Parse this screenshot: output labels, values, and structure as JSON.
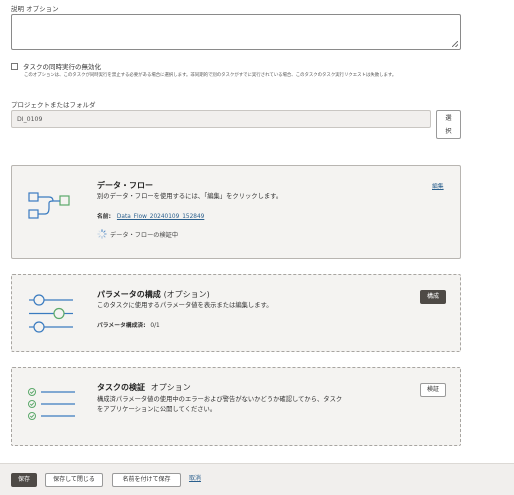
{
  "description": {
    "label": "説明 オプション"
  },
  "disable_concurrent": {
    "label": "タスクの同時実行の無効化",
    "help": "このオプションは、このタスクが同時実行を禁止する必要がある場合に選択します。非同期的で別のタスクがすでに実行されている場合、このタスクのタスク実行リクエストは失敗します。"
  },
  "project": {
    "label": "プロジェクトまたはフォルダ",
    "value": "DI_0109",
    "select_button": "選\n択"
  },
  "data_flow_card": {
    "title": "データ・フロー",
    "description": "別のデータ・フローを使用するには、「編集」をクリックします。",
    "name_label": "名前:",
    "name_value": "Data_Flow_20240109_152849",
    "status": "データ・フローの検証中",
    "edit_link": "編集"
  },
  "parameters_card": {
    "title": "パラメータの構成",
    "optional": "(オプション)",
    "description": "このタスクに使用するパラメータ値を表示または編集します。",
    "configured_label": "パラメータ構成済:",
    "configured_value": "0/1",
    "button": "構成"
  },
  "validation_card": {
    "title": "タスクの検証",
    "optional": "オプション",
    "description_line1": "構成済パラメータ値の使用中のエラーおよび警告がないかどうか確認してから、タスク",
    "description_line2": "をアプリケーションに公開してください。",
    "button": "検証"
  },
  "footer": {
    "save": "保存",
    "save_close": "保存して閉じる",
    "save_as": "名前を付けて保存",
    "cancel": "取消"
  },
  "colors": {
    "accent_green": "#5aa86a",
    "accent_blue": "#3a7bc0",
    "dark_button": "#4e4a46",
    "link": "#2a5f8d"
  }
}
